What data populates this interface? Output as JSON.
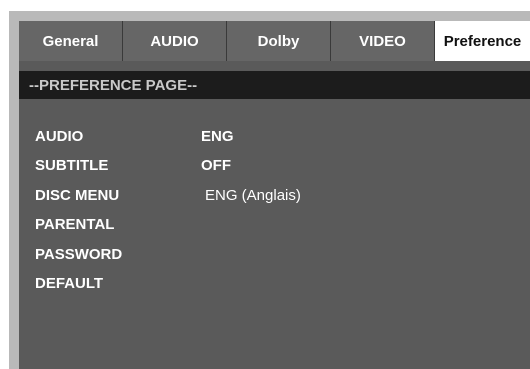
{
  "tabs": [
    {
      "label": "General"
    },
    {
      "label": "AUDIO"
    },
    {
      "label": "Dolby"
    },
    {
      "label": "VIDEO"
    },
    {
      "label": "Preference",
      "active": true
    }
  ],
  "page_title": "--PREFERENCE PAGE--",
  "settings": [
    {
      "label": "AUDIO",
      "value": "ENG"
    },
    {
      "label": "SUBTITLE",
      "value": "OFF"
    },
    {
      "label": "DISC MENU",
      "value": "ENG (Anglais)"
    },
    {
      "label": "PARENTAL",
      "value": ""
    },
    {
      "label": "PASSWORD",
      "value": ""
    },
    {
      "label": "DEFAULT",
      "value": ""
    }
  ],
  "colors": {
    "panel": "#5a5a5a",
    "tab": "#666666",
    "active_tab": "#ffffff",
    "section_bar": "#1c1c1c",
    "frame": "#b9b9b9"
  }
}
